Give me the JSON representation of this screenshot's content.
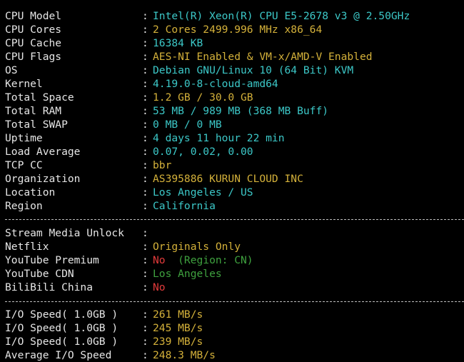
{
  "colors": {
    "cyan": "#3cc8c8",
    "yellow": "#d4b13a",
    "red": "#e23b3b",
    "green": "#3fa23f",
    "label": "#e6e6e6"
  },
  "system": [
    {
      "label": "CPU Model",
      "value": "Intel(R) Xeon(R) CPU E5-2678 v3 @ 2.50GHz",
      "color": "cyan"
    },
    {
      "label": "CPU Cores",
      "value": "2 Cores 2499.996 MHz x86_64",
      "color": "yellow"
    },
    {
      "label": "CPU Cache",
      "value": "16384 KB",
      "color": "cyan"
    },
    {
      "label": "CPU Flags",
      "value": "AES-NI Enabled & VM-x/AMD-V Enabled",
      "color": "yellow"
    },
    {
      "label": "OS",
      "value": "Debian GNU/Linux 10 (64 Bit) KVM",
      "color": "cyan"
    },
    {
      "label": "Kernel",
      "value": "4.19.0-8-cloud-amd64",
      "color": "cyan"
    },
    {
      "label": "Total Space",
      "value": "1.2 GB / 30.0 GB",
      "color": "yellow"
    },
    {
      "label": "Total RAM",
      "value": "53 MB / 989 MB (368 MB Buff)",
      "color": "cyan"
    },
    {
      "label": "Total SWAP",
      "value": "0 MB / 0 MB",
      "color": "cyan"
    },
    {
      "label": "Uptime",
      "value": "4 days 11 hour 22 min",
      "color": "cyan"
    },
    {
      "label": "Load Average",
      "value": "0.07, 0.02, 0.00",
      "color": "cyan"
    },
    {
      "label": "TCP CC",
      "value": "bbr",
      "color": "yellow"
    },
    {
      "label": "Organization",
      "value": "AS395886 KURUN CLOUD INC",
      "color": "yellow"
    },
    {
      "label": "Location",
      "value": "Los Angeles / US",
      "color": "cyan"
    },
    {
      "label": "Region",
      "value": "California",
      "color": "cyan"
    }
  ],
  "media": {
    "header": "Stream Media Unlock",
    "rows": [
      {
        "label": "Netflix",
        "parts": [
          {
            "text": "Originals Only",
            "color": "yellow"
          }
        ]
      },
      {
        "label": "YouTube Premium",
        "parts": [
          {
            "text": "No",
            "color": "red"
          },
          {
            "text": "  (Region: CN)",
            "color": "green"
          }
        ]
      },
      {
        "label": "YouTube CDN",
        "parts": [
          {
            "text": "Los Angeles",
            "color": "green"
          }
        ]
      },
      {
        "label": "BiliBili China",
        "parts": [
          {
            "text": "No",
            "color": "red"
          }
        ]
      }
    ]
  },
  "io": [
    {
      "label": "I/O Speed( 1.0GB )",
      "value": "261 MB/s",
      "color": "yellow"
    },
    {
      "label": "I/O Speed( 1.0GB )",
      "value": "245 MB/s",
      "color": "yellow"
    },
    {
      "label": "I/O Speed( 1.0GB )",
      "value": "239 MB/s",
      "color": "yellow"
    },
    {
      "label": "Average I/O Speed",
      "value": "248.3 MB/s",
      "color": "yellow"
    }
  ],
  "separator_char": ":"
}
